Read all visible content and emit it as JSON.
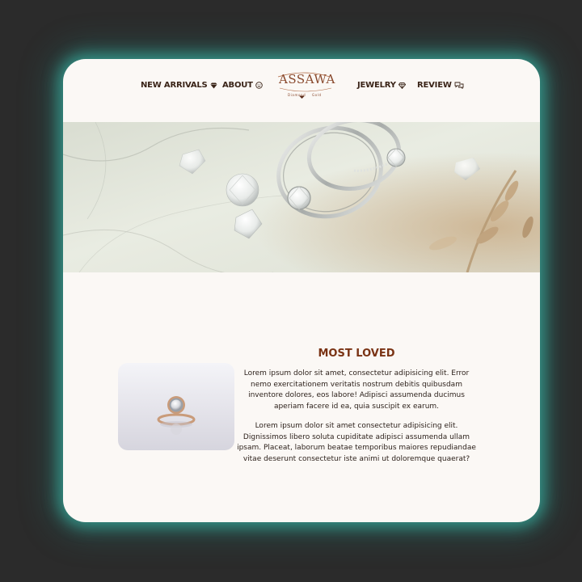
{
  "nav": {
    "items": [
      {
        "label": "NEW ARRIVALS",
        "icon": "gem-icon"
      },
      {
        "label": "ABOUT",
        "icon": "smile-icon"
      },
      {
        "label": "JEWELRY",
        "icon": "diamond-icon"
      },
      {
        "label": "REVIEW",
        "icon": "chat-bubbles-icon"
      }
    ]
  },
  "logo": {
    "name": "Assawa",
    "word": "ASSAWA",
    "sub_left": "Diamond",
    "sub_right": "Gold"
  },
  "hero": {
    "image": "diamond-rings-on-marble-photo"
  },
  "most_loved": {
    "title": "MOST LOVED",
    "image": "rose-gold-halo-ring-photo",
    "paragraph1": "Lorem ipsum dolor sit amet, consectetur adipisicing elit. Error nemo exercitationem veritatis nostrum debitis quibusdam inventore dolores, eos labore! Adipisci assumenda ducimus aperiam facere id ea, quia suscipit ex earum.",
    "paragraph2": "Lorem ipsum dolor sit amet consectetur adipisicing elit. Dignissimos libero soluta cupiditate adipisci assumenda ullam ipsam. Placeat, laborum beatae temporibus maiores repudiandae vitae deserunt consectetur iste animi ut doloremque quaerat?"
  },
  "colors": {
    "page_bg": "#2b2b2b",
    "card_bg": "#fbf8f5",
    "glow": "#3cd2be",
    "nav_text": "#3a2418",
    "accent": "#7a3314",
    "logo": "#8a4a2e"
  }
}
